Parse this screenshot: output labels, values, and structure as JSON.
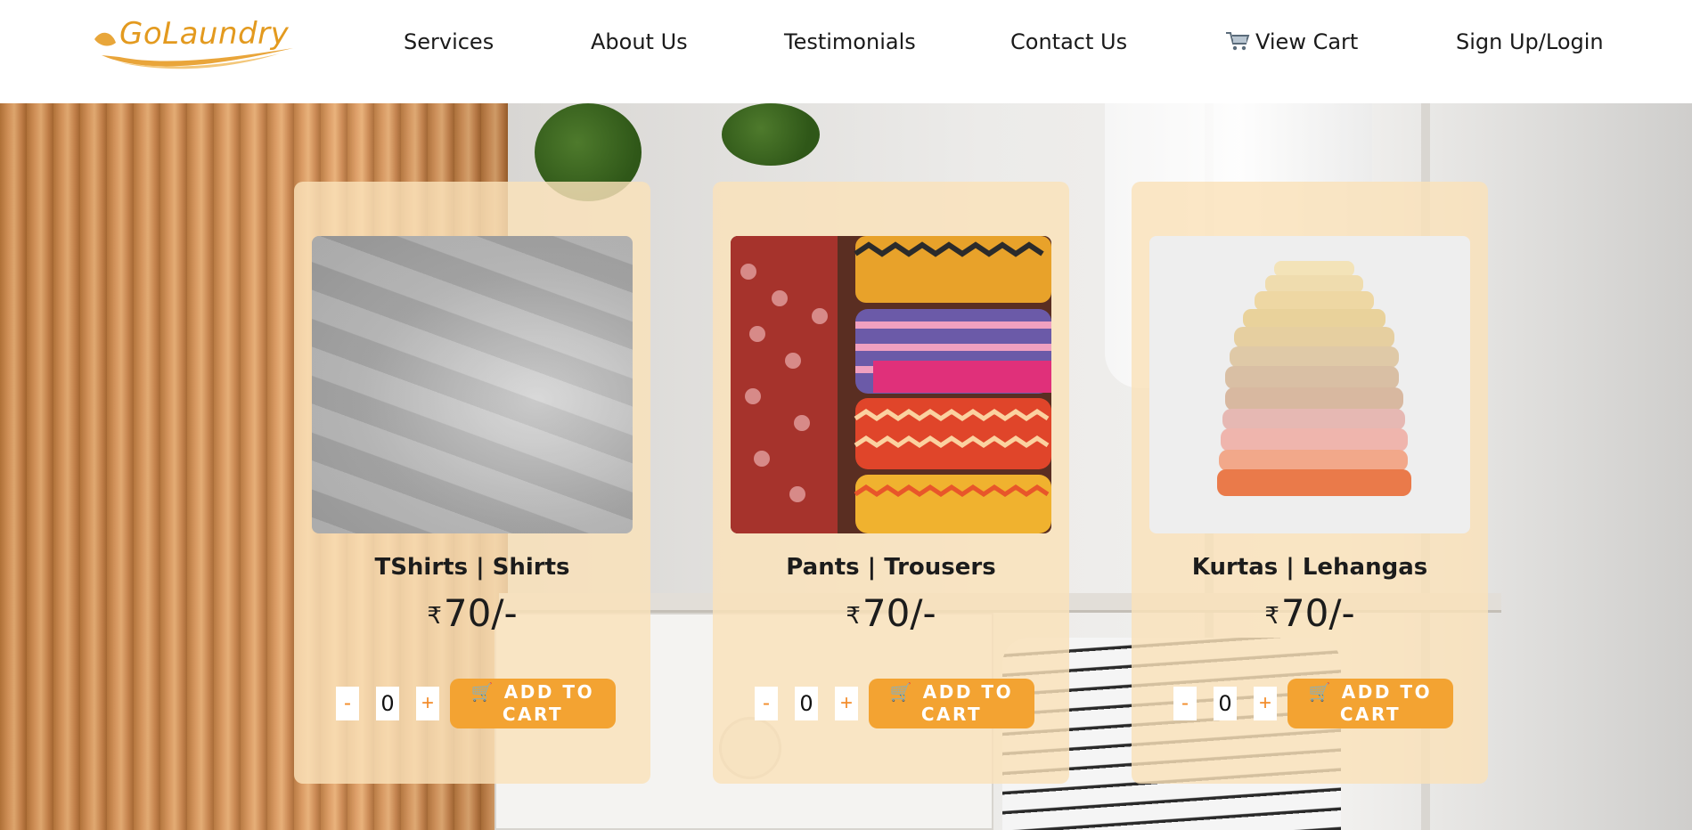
{
  "brand": {
    "name": "GoLaundry",
    "accent": "#e39a1f"
  },
  "nav": {
    "services": "Services",
    "about": "About Us",
    "testimonials": "Testimonials",
    "contact": "Contact Us",
    "cart": "View Cart",
    "cart_icon": "shopping-cart-icon",
    "login": "Sign Up/Login"
  },
  "cards": [
    {
      "title": "TShirts | Shirts",
      "currency": "₹",
      "price": "70/-",
      "qty": "0",
      "minus": "-",
      "plus": "+",
      "cta": "🛒 ADD TO CART"
    },
    {
      "title": "Pants | Trousers",
      "currency": "₹",
      "price": "70/-",
      "qty": "0",
      "minus": "-",
      "plus": "+",
      "cta": "🛒 ADD TO CART"
    },
    {
      "title": "Kurtas | Lehangas",
      "currency": "₹",
      "price": "70/-",
      "qty": "0",
      "minus": "-",
      "plus": "+",
      "cta": "🛒 ADD TO CART"
    }
  ],
  "colors": {
    "button": "#f3a332",
    "card_bg": "#fae2b9",
    "qty_symbol": "#f28c2a"
  }
}
